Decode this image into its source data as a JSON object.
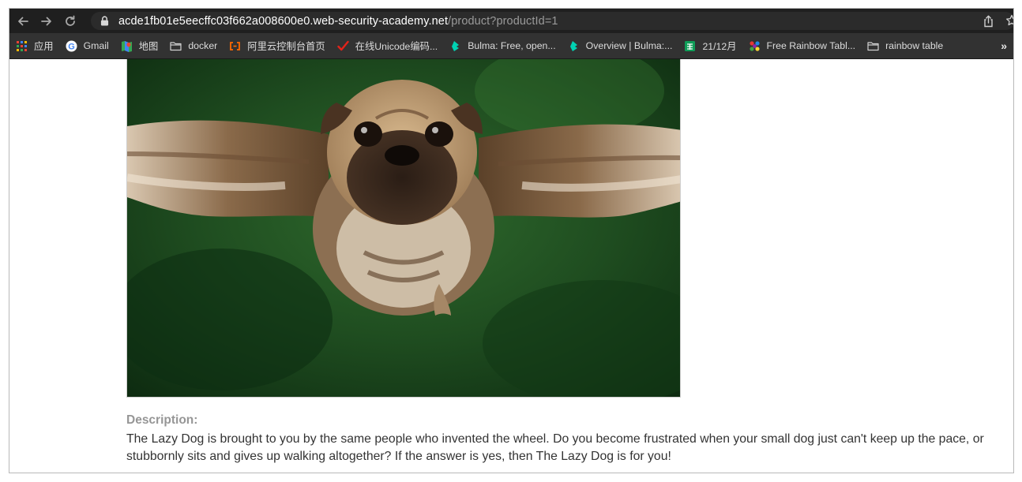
{
  "browser": {
    "url_host": "acde1fb01e5eecffc03f662a008600e0.web-security-academy.net",
    "url_path": "/product?productId=1",
    "bookmarks": [
      {
        "label": "应用",
        "icon": "apps-grid-icon"
      },
      {
        "label": "Gmail",
        "icon": "google-icon"
      },
      {
        "label": "地图",
        "icon": "maps-icon"
      },
      {
        "label": "docker",
        "icon": "folder-icon"
      },
      {
        "label": "阿里云控制台首页",
        "icon": "aliyun-icon"
      },
      {
        "label": "在线Unicode编码...",
        "icon": "check-icon"
      },
      {
        "label": "Bulma: Free, open...",
        "icon": "bulma-icon"
      },
      {
        "label": "Overview | Bulma:...",
        "icon": "bulma-icon"
      },
      {
        "label": "21/12月",
        "icon": "sheets-icon"
      },
      {
        "label": "Free Rainbow Tabl...",
        "icon": "rainbow-icon"
      },
      {
        "label": "rainbow table",
        "icon": "folder-icon"
      }
    ],
    "more_label": "»"
  },
  "product": {
    "image_alt": "pug with owl wings",
    "description_label": "Description:",
    "description": "The Lazy Dog is brought to you by the same people who invented the wheel. Do you become frustrated when your small dog just can't keep up the pace, or stubbornly sits and gives up walking altogether? If the answer is yes, then The Lazy Dog is for you!"
  },
  "colors": {
    "toolbar_bg": "#1f1f1f",
    "bookmarks_bg": "#323232",
    "image_bg": "#1d4a1f",
    "description_label": "#969696",
    "text": "#333333"
  }
}
